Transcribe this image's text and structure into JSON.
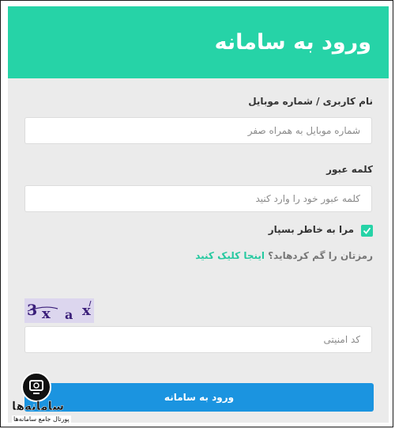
{
  "header": {
    "title": "ورود به سامانه"
  },
  "form": {
    "username_label": "نام کاربری / شماره موبایل",
    "username_placeholder": "شماره موبایل به همراه صفر",
    "password_label": "کلمه عبور",
    "password_placeholder": "کلمه عبور خود را وارد کنید",
    "remember_label": "مرا به خاطر بسپار",
    "remember_checked": true,
    "forgot_text": "رمزتان را گم کردهاید؟",
    "forgot_link": "اینجا کلیک کنید",
    "captcha_chars": [
      "3",
      "x",
      "a",
      "x"
    ],
    "captcha_placeholder": "کد امنیتی",
    "submit_label": "ورود به سامانه"
  },
  "watermark": {
    "name": "سامانه‌ها",
    "tagline": "پورتال جامع سامانه‌ها"
  },
  "colors": {
    "accent": "#26d3a7",
    "button": "#1b94e0",
    "panel": "#ebebeb"
  }
}
